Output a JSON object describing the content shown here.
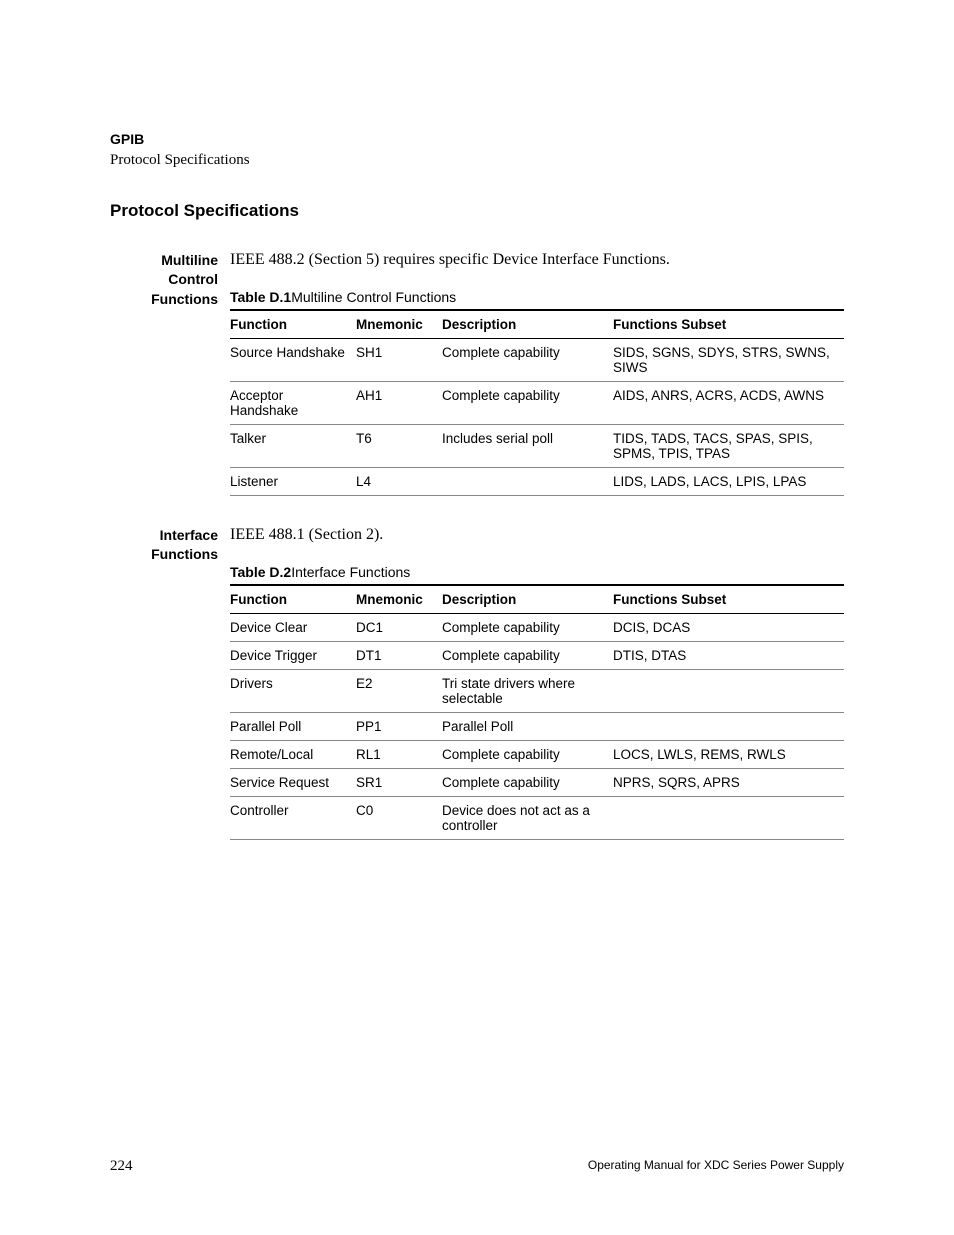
{
  "header": {
    "chapter": "GPIB",
    "section": "Protocol Specifications"
  },
  "heading": "Protocol Specifications",
  "sections": [
    {
      "sideLabel": "Multiline Control Functions",
      "body": "IEEE 488.2 (Section 5) requires specific Device Interface Functions.",
      "table": {
        "captionLabel": "Table D.1",
        "captionText": "Multiline Control Functions",
        "headers": [
          "Function",
          "Mnemonic",
          "Description",
          "Functions Subset"
        ],
        "rows": [
          [
            "Source Handshake",
            "SH1",
            "Complete capability",
            "SIDS, SGNS, SDYS, STRS, SWNS, SIWS"
          ],
          [
            "Acceptor Handshake",
            "AH1",
            "Complete capability",
            "AIDS, ANRS, ACRS, ACDS, AWNS"
          ],
          [
            "Talker",
            "T6",
            "Includes serial poll",
            "TIDS, TADS, TACS, SPAS, SPIS, SPMS, TPIS, TPAS"
          ],
          [
            "Listener",
            "L4",
            "",
            "LIDS, LADS, LACS, LPIS, LPAS"
          ]
        ]
      }
    },
    {
      "sideLabel": "Interface Functions",
      "body": "IEEE 488.1 (Section 2).",
      "table": {
        "captionLabel": "Table D.2",
        "captionText": "Interface Functions",
        "headers": [
          "Function",
          "Mnemonic",
          "Description",
          "Functions Subset"
        ],
        "rows": [
          [
            "Device Clear",
            "DC1",
            "Complete capability",
            "DCIS, DCAS"
          ],
          [
            "Device Trigger",
            "DT1",
            "Complete capability",
            "DTIS, DTAS"
          ],
          [
            "Drivers",
            "E2",
            "Tri state drivers where selectable",
            ""
          ],
          [
            "Parallel Poll",
            "PP1",
            "Parallel Poll",
            ""
          ],
          [
            "Remote/Local",
            "RL1",
            "Complete capability",
            "LOCS, LWLS, REMS, RWLS"
          ],
          [
            "Service Request",
            "SR1",
            "Complete capability",
            "NPRS, SQRS, APRS"
          ],
          [
            "Controller",
            "C0",
            "Device does not act as a controller",
            ""
          ]
        ]
      }
    }
  ],
  "footer": {
    "pageNumber": "224",
    "text": "Operating Manual for XDC Series Power Supply"
  }
}
